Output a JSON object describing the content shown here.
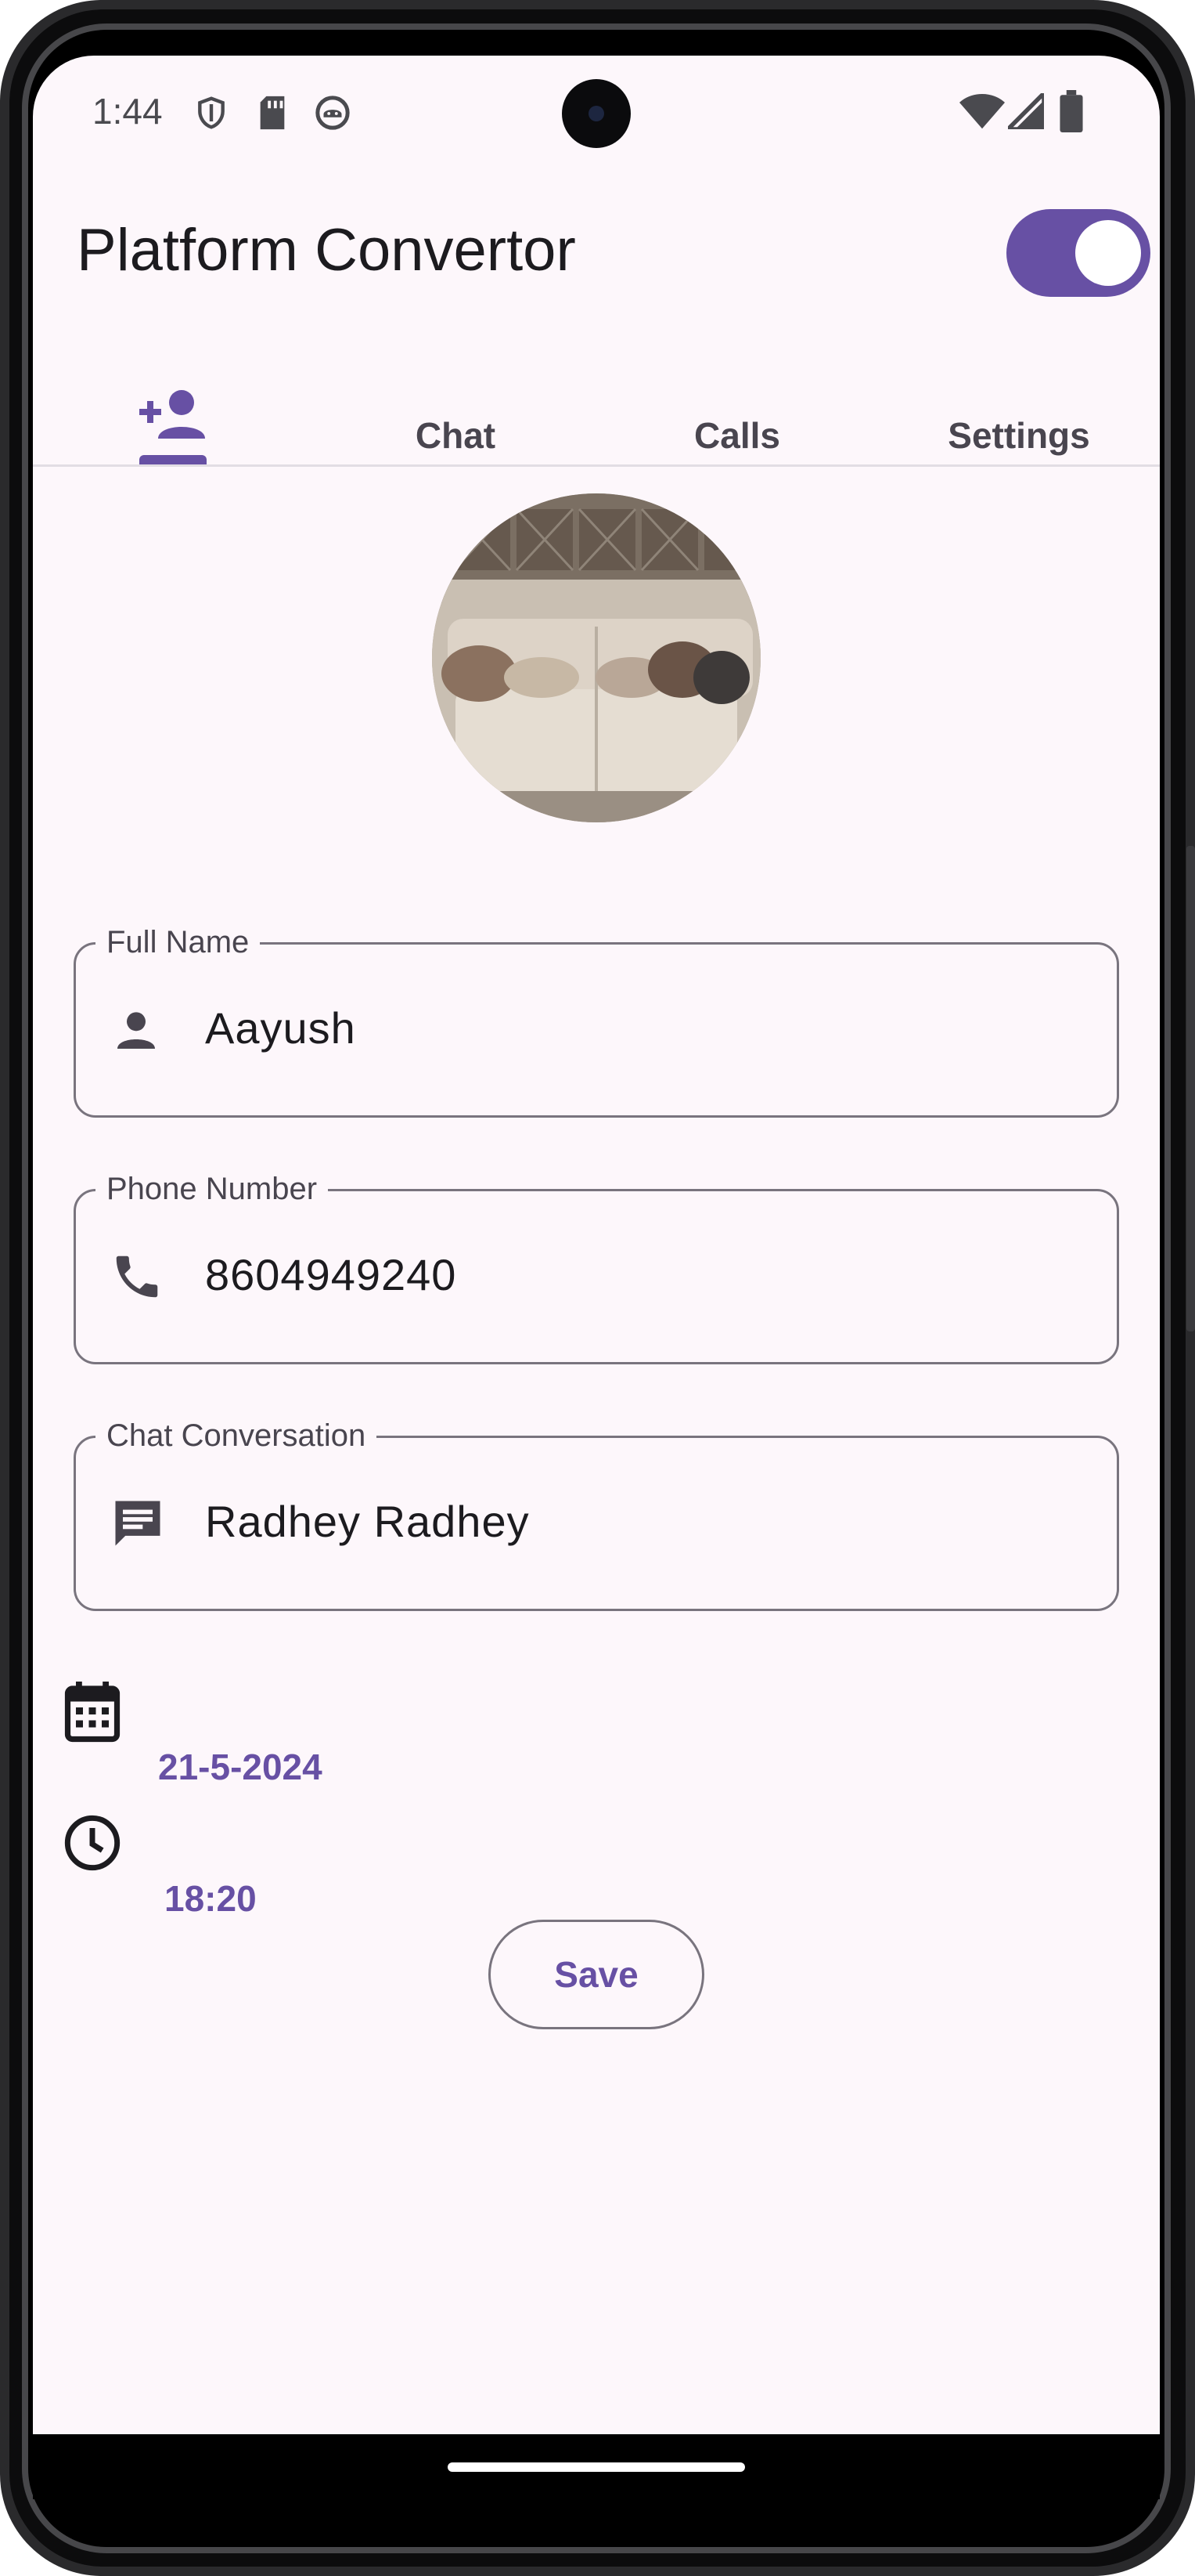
{
  "status_bar": {
    "time": "1:44",
    "left_icons": [
      "shield-icon",
      "sd-card-icon",
      "android-icon"
    ],
    "right_icons": [
      "wifi-icon",
      "signal-icon",
      "battery-icon"
    ]
  },
  "app_bar": {
    "title": "Platform Convertor",
    "toggle_on": true
  },
  "tabs": [
    {
      "icon": "add-person-icon",
      "label": "",
      "selected": true
    },
    {
      "label": "Chat",
      "selected": false
    },
    {
      "label": "Calls",
      "selected": false
    },
    {
      "label": "Settings",
      "selected": false
    }
  ],
  "profile": {
    "avatar": "sofa-photo"
  },
  "form": {
    "full_name": {
      "label": "Full Name",
      "value": "Aayush",
      "icon": "person-icon"
    },
    "phone": {
      "label": "Phone Number",
      "value": "8604949240",
      "icon": "phone-icon"
    },
    "chat": {
      "label": "Chat Conversation",
      "value": "Radhey Radhey",
      "icon": "chat-icon"
    },
    "date": {
      "value": "21-5-2024",
      "icon": "calendar-icon"
    },
    "time": {
      "value": "18:20",
      "icon": "clock-icon"
    },
    "save_label": "Save"
  },
  "colors": {
    "accent": "#6750a4",
    "background": "#fdf7fb",
    "outline": "#79747e",
    "text": "#1c1b1f"
  }
}
